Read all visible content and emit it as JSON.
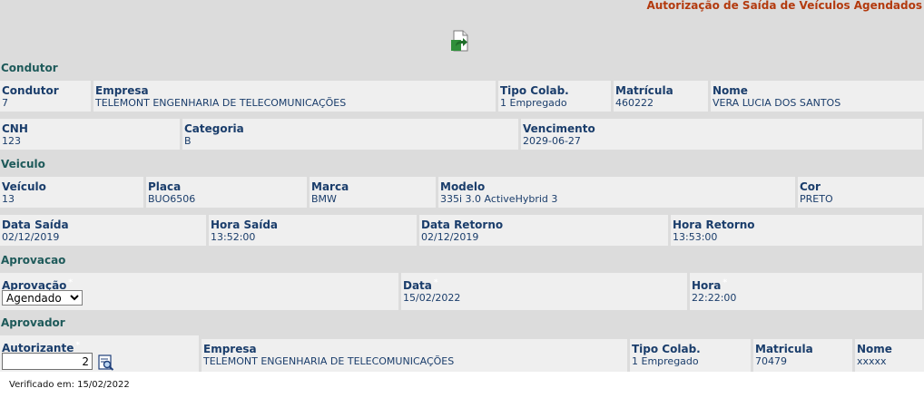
{
  "title": "Autorização de Saída de Veículos Agendados",
  "icons": {
    "top": "export-document-icon",
    "lookup": "search-lookup-icon"
  },
  "sections": {
    "condutor": "Condutor",
    "veiculo": "Veiculo",
    "aprovacao": "Aprovacao",
    "aprovador": "Aprovador"
  },
  "condutor": {
    "condutor": {
      "label": "Condutor",
      "value": "7"
    },
    "empresa": {
      "label": "Empresa",
      "value": "TELEMONT ENGENHARIA DE TELECOMUNICAÇÕES"
    },
    "tipo_colab": {
      "label": "Tipo Colab.",
      "value": "1 Empregado"
    },
    "matricula": {
      "label": "Matrícula",
      "value": "460222"
    },
    "nome": {
      "label": "Nome",
      "value": "VERA LUCIA DOS SANTOS"
    },
    "cnh": {
      "label": "CNH",
      "value": "123"
    },
    "categoria": {
      "label": "Categoria",
      "value": "B"
    },
    "vencimento": {
      "label": "Vencimento",
      "value": "2029-06-27"
    }
  },
  "veiculo": {
    "veiculo": {
      "label": "Veículo",
      "value": "13"
    },
    "placa": {
      "label": "Placa",
      "value": "BUO6506"
    },
    "marca": {
      "label": "Marca",
      "value": "BMW"
    },
    "modelo": {
      "label": "Modelo",
      "value": "335i 3.0 ActiveHybrid 3"
    },
    "cor": {
      "label": "Cor",
      "value": "PRETO"
    },
    "data_saida": {
      "label": "Data Saída",
      "value": "02/12/2019"
    },
    "hora_saida": {
      "label": "Hora Saída",
      "value": "13:52:00"
    },
    "data_retorno": {
      "label": "Data Retorno",
      "value": "02/12/2019"
    },
    "hora_retorno": {
      "label": "Hora Retorno",
      "value": "13:53:00"
    }
  },
  "aprovacao": {
    "aprovacao": {
      "label": "Aprovação",
      "selected": "Agendado"
    },
    "data": {
      "label": "Data",
      "value": "15/02/2022"
    },
    "hora": {
      "label": "Hora",
      "value": "22:22:00"
    }
  },
  "aprovador": {
    "autorizante": {
      "label": "Autorizante",
      "value": "2"
    },
    "empresa": {
      "label": "Empresa",
      "value": "TELEMONT ENGENHARIA DE TELECOMUNICAÇÕES"
    },
    "tipo_colab": {
      "label": "Tipo Colab.",
      "value": "1 Empregado"
    },
    "matricula": {
      "label": "Matricula",
      "value": "70479"
    },
    "nome": {
      "label": "Nome",
      "value": "xxxxx"
    }
  },
  "required_mark": "*",
  "footer": "Verificado em: 15/02/2022"
}
